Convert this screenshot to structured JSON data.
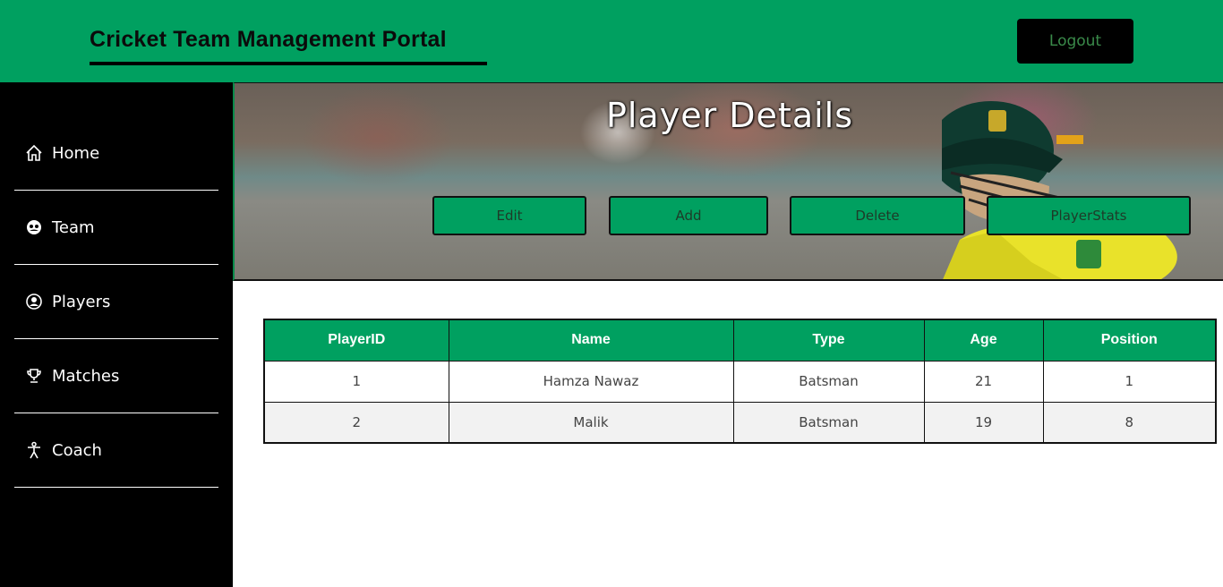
{
  "header": {
    "title": "Cricket Team Management Portal",
    "logout_label": "Logout",
    "brand_color": "#00a060"
  },
  "sidebar": {
    "items": [
      {
        "label": "Home",
        "icon": "home-icon"
      },
      {
        "label": "Team",
        "icon": "team-icon"
      },
      {
        "label": "Players",
        "icon": "user-circle-icon"
      },
      {
        "label": "Matches",
        "icon": "trophy-icon"
      },
      {
        "label": "Coach",
        "icon": "person-icon"
      }
    ]
  },
  "banner": {
    "title": "Player Details",
    "buttons": {
      "edit": "Edit",
      "add": "Add",
      "delete": "Delete",
      "stats": "PlayerStats"
    }
  },
  "table": {
    "columns": [
      "PlayerID",
      "Name",
      "Type",
      "Age",
      "Position"
    ],
    "rows": [
      [
        "1",
        "Hamza Nawaz",
        "Batsman",
        "21",
        "1"
      ],
      [
        "2",
        "Malik",
        "Batsman",
        "19",
        "8"
      ]
    ]
  }
}
